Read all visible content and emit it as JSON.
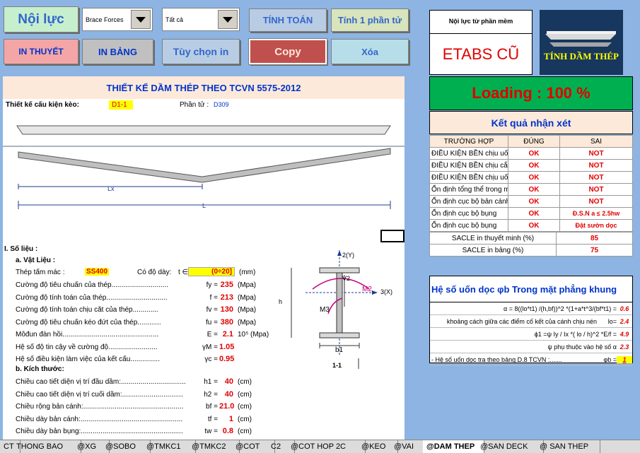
{
  "toolbar": {
    "noi_luc": "Nội lực",
    "brace_forces": "Brace Forces",
    "tat_ca": "Tất cả",
    "tinh_toan": "TÍNH TOÁN",
    "tinh_1_phan_tu": "Tính 1 phần tử",
    "in_thuyet": "IN THUYẾT",
    "in_bang": "IN BẢNG",
    "tuy_chon_in": "Tùy chọn in",
    "copy": "Copy",
    "xoa": "Xóa"
  },
  "right": {
    "noi_luc_label": "Nội lực từ phần mềm",
    "etabs": "ETABS CŨ",
    "logo_text": "TÍNH DẦM THÉP",
    "loading": "Loading : 100 %",
    "ket_qua": "Kết quả nhận xét",
    "headers": [
      "TRƯỜNG HỢP",
      "ĐÚNG",
      "SAI"
    ],
    "rows": [
      {
        "case": "ĐIỀU KIỆN BỀN chịu uốn",
        "ok": "OK",
        "sai": "NOT"
      },
      {
        "case": "ĐIỀU KIỆN BỀN chịu cắt",
        "ok": "OK",
        "sai": "NOT"
      },
      {
        "case": "ĐIỀU KIỆN BỀN chịu uốn cắt",
        "ok": "OK",
        "sai": "NOT"
      },
      {
        "case": "Ổn định tổng thể trong mặt",
        "ok": "OK",
        "sai": "NOT"
      },
      {
        "case": "Ổn định cục bộ bản cánh",
        "ok": "OK",
        "sai": "NOT"
      },
      {
        "case": "Ổn định cục bộ bụng",
        "ok": "OK",
        "sai": "Đ.S.N a ≤ 2.5hw"
      },
      {
        "case": "Ổn định cục bộ bụng",
        "ok": "OK",
        "sai": "Đặt sườn dọc"
      }
    ],
    "scale_thuyet_label": "SACLE in thuyết minh (%)",
    "scale_thuyet_val": "85",
    "scale_bang_label": "SACLE in bảng (%)",
    "scale_bang_val": "75",
    "heso_title": "Hệ số uốn dọc φb Trong mặt phẳng khung",
    "heso_rows": [
      {
        "label": "α = 8((lo*t1) /(h,bf))^2 *(1+a*t^3/(bf*t1) =",
        "val": "0.6"
      },
      {
        "label": "khoảng cách giữa các điểm cố kết của cánh chịu nén",
        "sym": "lo=",
        "val": "2.4"
      },
      {
        "label": "ϕ1 =ψ Iy / Ix *( lo / h)^2 *E/f =",
        "val": "4.9"
      },
      {
        "label": "ψ phụ thuộc vào hệ số α",
        "val": "2.3"
      },
      {
        "label": "- Hệ số uốn dọc tra theo bảng D.8 TCVN :.......",
        "sym": "φb =",
        "val": "1"
      }
    ]
  },
  "sheet": {
    "title": "THIẾT KẾ DẦM THÉP THEO TCVN 5575-2012",
    "cau_kien_label": "Thiết kế cấu kiện kèo:",
    "cau_kien_val": "D1-1",
    "phan_tu_label": "Phần tử :",
    "phan_tu_val": "D309",
    "lx": "Lx",
    "l": "L",
    "so_lieu": "I.  Số liệu :",
    "vat_lieu": "a.  Vật Liệu :",
    "thep_label": "Thép tấm mác :",
    "thep_val": "SS400",
    "do_day_label": "Có độ dày:",
    "do_day_sym": "t ∈",
    "do_day_val": "(0÷20]",
    "do_day_unit": "(mm)",
    "props": [
      {
        "label": "Cường độ tiêu chuẩn của thép.............................",
        "sym": "fy =",
        "val": "235",
        "unit": "(Mpa)"
      },
      {
        "label": "Cường độ tính toán của thép...............................",
        "sym": "f =",
        "val": "213",
        "unit": "(Mpa)"
      },
      {
        "label": "Cường độ tính toán chịu cắt của thép.............",
        "sym": "fv =",
        "val": "130",
        "unit": "(Mpa)"
      },
      {
        "label": "Cường độ tiêu chuẩn kéo đứt của thép............",
        "sym": "fu =",
        "val": "380",
        "unit": "(Mpa)"
      },
      {
        "label": "Môđun đàn hồi.................................................",
        "sym": "E =",
        "val": "2.1",
        "unit": "10⁵ (Mpa)"
      },
      {
        "label": "Hệ số độ tin cậy về cường độ.........................",
        "sym": "γM =",
        "val": "1.05",
        "unit": ""
      },
      {
        "label": "Hệ số điều kiện làm việc của kết cấu...............",
        "sym": "γc =",
        "val": "0.95",
        "unit": ""
      }
    ],
    "kich_thuoc": "b.  Kích thước:",
    "dims": [
      {
        "label": "Chiều cao tiết diện vị trí đầu dầm:.................................",
        "sym": "h1 =",
        "val": "40",
        "unit": "(cm)"
      },
      {
        "label": "Chiều cao tiết diện vị trí cuối dầm:...............................",
        "sym": "h2 =",
        "val": "40",
        "unit": "(cm)"
      },
      {
        "label": "Chiều rộng bản cánh:...................................................",
        "sym": "bf =",
        "val": "21.0",
        "unit": "(cm)"
      },
      {
        "label": "Chiều dày bản cánh:....................................................",
        "sym": "tf =",
        "val": "1",
        "unit": "(cm)"
      },
      {
        "label": "Chiều dày bản bụng:....................................................",
        "sym": "tw =",
        "val": "0.8",
        "unit": "(cm)"
      }
    ],
    "section": {
      "y2": "2(Y)",
      "x3": "3(X)",
      "v2": "V2",
      "m2": "M2",
      "m3": "M3",
      "h": "h",
      "b1": "b1",
      "cut": "1-1"
    }
  },
  "tabs": [
    "CT",
    "THONG BAO",
    "@XG",
    "@SOBO",
    "@TMKC1",
    "@TMKC2",
    "@COT",
    "C2",
    "@COT HOP 2C",
    "@KEO",
    "@VAI",
    "@DAM THEP",
    "@SAN DECK",
    "@ SAN THEP"
  ],
  "colors": {
    "bg": "#8db4e2",
    "red": "#e00000",
    "green": "#00b050",
    "peach": "#fde9d9",
    "title_blue": "#0033cc"
  }
}
